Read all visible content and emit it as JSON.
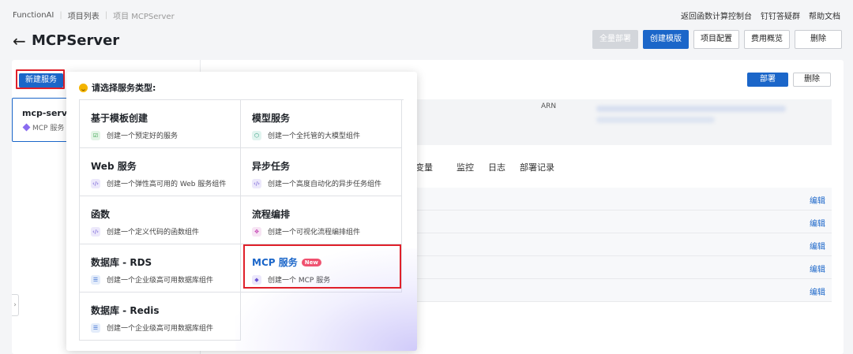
{
  "breadcrumb": {
    "root": "FunctionAI",
    "projects": "项目列表",
    "current": "项目 MCPServer"
  },
  "toplinks": [
    "返回函数计算控制台",
    "钉钉答疑群",
    "帮助文档"
  ],
  "header": {
    "title": "MCPServer",
    "buttons": {
      "deploy_all": "全量部署",
      "create_template": "创建模版",
      "project_config": "项目配置",
      "cost_overview": "费用概览",
      "delete": "删除"
    }
  },
  "sidebar": {
    "new_service": "新建服务",
    "service_card": {
      "name": "mcp-server",
      "sub": "MCP 服务"
    }
  },
  "detail": {
    "deploy": "部署",
    "delete": "删除",
    "arn_label": "ARN",
    "tabs": [
      "务变量",
      "监控",
      "日志",
      "部署记录"
    ],
    "edit_label": "编辑"
  },
  "popover": {
    "title": "请选择服务类型:",
    "items": [
      {
        "title": "基于模板创建",
        "desc": "创建一个预定好的服务",
        "icon": "template-icon",
        "icon_color": "#2f9e44"
      },
      {
        "title": "模型服务",
        "desc": "创建一个全托管的大模型组件",
        "icon": "cube-icon",
        "icon_color": "#1c8f6f"
      },
      {
        "title": "Web 服务",
        "desc": "创建一个弹性高可用的 Web 服务组件",
        "icon": "code-icon",
        "icon_color": "#6b54d3"
      },
      {
        "title": "异步任务",
        "desc": "创建一个高度自动化的异步任务组件",
        "icon": "code-icon",
        "icon_color": "#6b54d3"
      },
      {
        "title": "函数",
        "desc": "创建一个定义代码的函数组件",
        "icon": "code-icon",
        "icon_color": "#6b54d3"
      },
      {
        "title": "流程编排",
        "desc": "创建一个可视化流程编排组件",
        "icon": "flow-icon",
        "icon_color": "#c43fb2"
      },
      {
        "title": "数据库 - RDS",
        "desc": "创建一个企业级高可用数据库组件",
        "icon": "database-icon",
        "icon_color": "#3b6fd1"
      },
      {
        "title": "MCP 服务",
        "badge": "New",
        "desc": "创建一个 MCP 服务",
        "icon": "mcp-icon",
        "icon_color": "#6b54d3"
      },
      {
        "title": "数据库 - Redis",
        "desc": "创建一个企业级高可用数据库组件",
        "icon": "database-icon",
        "icon_color": "#3b6fd1"
      }
    ]
  }
}
